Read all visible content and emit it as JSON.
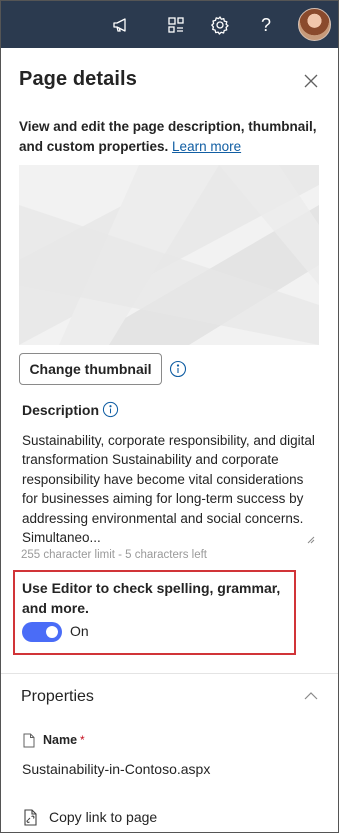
{
  "topbar": {
    "icons": [
      "megaphone-icon",
      "app-switcher-icon",
      "settings-gear-icon",
      "help-icon"
    ],
    "help_glyph": "?"
  },
  "panel": {
    "title": "Page details",
    "intro_text": "View and edit the page description, thumbnail, and custom properties.",
    "learn_more": "Learn more",
    "change_thumbnail_label": "Change thumbnail",
    "description_label": "Description",
    "description_value": "Sustainability, corporate responsibility, and digital transformation Sustainability and corporate responsibility have become vital considerations for businesses aiming for long-term success by addressing environmental and social concerns. Simultaneo...",
    "char_limit": "255 character limit - 5 characters left",
    "editor_label": "Use Editor to check spelling, grammar, and more.",
    "editor_toggle_state": "On",
    "editor_toggle_on": true
  },
  "properties": {
    "title": "Properties",
    "name_label": "Name",
    "required_marker": "*",
    "name_value": "Sustainability-in-Contoso.aspx",
    "copy_link_label": "Copy link to page"
  },
  "colors": {
    "topbar": "#2b3a4f",
    "accent": "#4a6cf7",
    "highlight_border": "#d13438",
    "link": "#115ea3"
  }
}
